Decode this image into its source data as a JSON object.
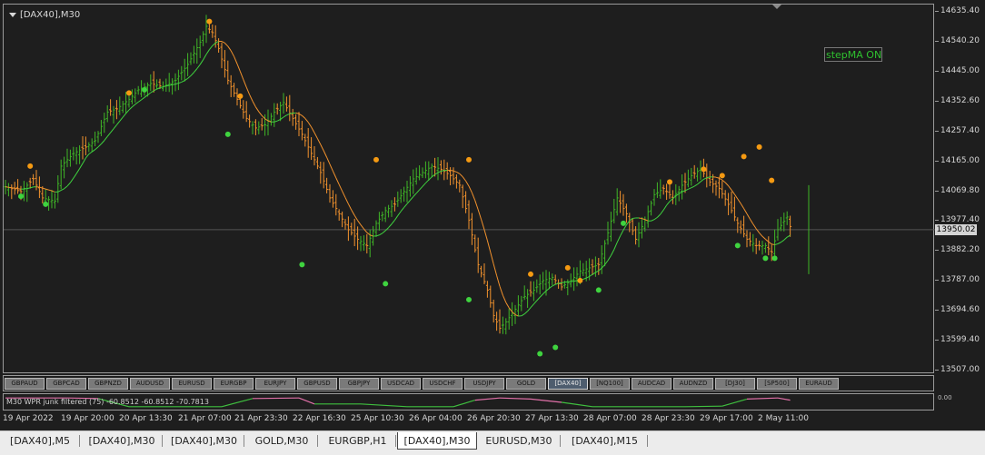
{
  "window": {
    "title": "[DAX40],M30"
  },
  "stepma_label": "stepMA ON",
  "price_axis": {
    "ticks": [
      "14635.40",
      "14540.20",
      "14445.00",
      "14352.60",
      "14257.40",
      "14165.00",
      "14069.80",
      "13977.40",
      "13882.20",
      "13787.00",
      "13694.60",
      "13599.40",
      "13507.00"
    ],
    "current": "13950.02"
  },
  "symbols": [
    "GBPAUD",
    "GBPCAD",
    "GBPNZD",
    "AUDUSD",
    "EURUSD",
    "EURGBP",
    "EURJPY",
    "GBPUSD",
    "GBPJPY",
    "USDCAD",
    "USDCHF",
    "USDJPY",
    "GOLD",
    "[DAX40]",
    "[NQ100]",
    "AUDCAD",
    "AUDNZD",
    "[DJ30]",
    "[SP500]",
    "EURAUD"
  ],
  "active_symbol": "[DAX40]",
  "indicator": {
    "label": "M30 WPR junk filtered (75) -60.8512 -60.8512 -70.7813",
    "axis_label": "0.00"
  },
  "time_axis": [
    "19 Apr 2022",
    "19 Apr 20:00",
    "20 Apr 13:30",
    "21 Apr 07:00",
    "21 Apr 23:30",
    "22 Apr 16:30",
    "25 Apr 10:30",
    "26 Apr 04:00",
    "26 Apr 20:30",
    "27 Apr 13:30",
    "28 Apr 07:00",
    "28 Apr 23:30",
    "29 Apr 17:00",
    "2 May 11:00"
  ],
  "tabs": [
    "[DAX40],M5",
    "[DAX40],M30",
    "[DAX40],M30",
    "GOLD,M30",
    "EURGBP,H1",
    "[DAX40],M30",
    "EURUSD,M30",
    "[DAX40],M15"
  ],
  "active_tab": 5,
  "colors": {
    "bull": "#3fb527",
    "bear": "#f2922d",
    "ma": "#f2922d",
    "signal": "#3fd33f",
    "wpr_high": "#e070a8",
    "wpr_low": "#3fbf3f"
  },
  "chart_data": {
    "type": "line",
    "ylim": [
      13507.0,
      14635.4
    ],
    "price_ticks": [
      14635.4,
      14540.2,
      14445.0,
      14352.6,
      14257.4,
      14165.0,
      14069.8,
      13977.4,
      13882.2,
      13787.0,
      13694.6,
      13599.4,
      13507.0
    ],
    "current_price": 13950.02,
    "x_labels": [
      "19 Apr 2022",
      "19 Apr 20:00",
      "20 Apr 13:30",
      "21 Apr 07:00",
      "21 Apr 23:30",
      "22 Apr 16:30",
      "25 Apr 10:30",
      "26 Apr 04:00",
      "26 Apr 20:30",
      "27 Apr 13:30",
      "28 Apr 07:00",
      "28 Apr 23:30",
      "29 Apr 17:00",
      "2 May 11:00"
    ],
    "close_keypoints": [
      [
        0,
        14085
      ],
      [
        5,
        14070
      ],
      [
        9,
        14110
      ],
      [
        12,
        14050
      ],
      [
        16,
        14040
      ],
      [
        18,
        14150
      ],
      [
        22,
        14190
      ],
      [
        26,
        14210
      ],
      [
        29,
        14230
      ],
      [
        33,
        14320
      ],
      [
        36,
        14330
      ],
      [
        40,
        14360
      ],
      [
        43,
        14390
      ],
      [
        47,
        14410
      ],
      [
        51,
        14400
      ],
      [
        55,
        14420
      ],
      [
        59,
        14470
      ],
      [
        63,
        14540
      ],
      [
        65,
        14590
      ],
      [
        67,
        14570
      ],
      [
        69,
        14520
      ],
      [
        72,
        14420
      ],
      [
        75,
        14360
      ],
      [
        78,
        14300
      ],
      [
        81,
        14270
      ],
      [
        84,
        14280
      ],
      [
        87,
        14320
      ],
      [
        90,
        14350
      ],
      [
        93,
        14300
      ],
      [
        96,
        14250
      ],
      [
        99,
        14190
      ],
      [
        102,
        14130
      ],
      [
        105,
        14050
      ],
      [
        108,
        14000
      ],
      [
        111,
        13950
      ],
      [
        114,
        13920
      ],
      [
        117,
        13900
      ],
      [
        120,
        13970
      ],
      [
        123,
        14010
      ],
      [
        126,
        14030
      ],
      [
        129,
        14070
      ],
      [
        132,
        14110
      ],
      [
        135,
        14130
      ],
      [
        138,
        14150
      ],
      [
        141,
        14140
      ],
      [
        144,
        14120
      ],
      [
        147,
        14090
      ],
      [
        150,
        13980
      ],
      [
        153,
        13840
      ],
      [
        156,
        13760
      ],
      [
        158,
        13680
      ],
      [
        160,
        13640
      ],
      [
        162,
        13660
      ],
      [
        165,
        13700
      ],
      [
        168,
        13740
      ],
      [
        171,
        13760
      ],
      [
        174,
        13790
      ],
      [
        177,
        13800
      ],
      [
        180,
        13770
      ],
      [
        183,
        13790
      ],
      [
        186,
        13820
      ],
      [
        189,
        13830
      ],
      [
        192,
        13840
      ],
      [
        195,
        13940
      ],
      [
        198,
        14050
      ],
      [
        201,
        14000
      ],
      [
        204,
        13920
      ],
      [
        207,
        13980
      ],
      [
        210,
        14060
      ],
      [
        213,
        14080
      ],
      [
        216,
        14050
      ],
      [
        219,
        14090
      ],
      [
        222,
        14120
      ],
      [
        225,
        14140
      ],
      [
        228,
        14100
      ],
      [
        231,
        14080
      ],
      [
        234,
        14030
      ],
      [
        237,
        13970
      ],
      [
        240,
        13920
      ],
      [
        243,
        13900
      ],
      [
        246,
        13900
      ],
      [
        248,
        13880
      ],
      [
        250,
        13950
      ],
      [
        253,
        13990
      ],
      [
        254,
        13960
      ]
    ],
    "wpr_levels": [
      [
        0,
        0.9
      ],
      [
        10,
        0.9
      ],
      [
        20,
        0.9
      ],
      [
        30,
        0.85
      ],
      [
        40,
        0.1
      ],
      [
        55,
        0.1
      ],
      [
        70,
        0.1
      ],
      [
        80,
        0.85
      ],
      [
        95,
        0.9
      ],
      [
        100,
        0.35
      ],
      [
        115,
        0.35
      ],
      [
        130,
        0.1
      ],
      [
        145,
        0.1
      ],
      [
        152,
        0.7
      ],
      [
        160,
        0.9
      ],
      [
        170,
        0.8
      ],
      [
        180,
        0.5
      ],
      [
        190,
        0.1
      ],
      [
        205,
        0.1
      ],
      [
        220,
        0.1
      ],
      [
        232,
        0.15
      ],
      [
        240,
        0.8
      ],
      [
        250,
        0.9
      ],
      [
        254,
        0.7
      ]
    ],
    "up_signals": [
      [
        5,
        14055
      ],
      [
        13,
        14030
      ],
      [
        45,
        14390
      ],
      [
        72,
        14250
      ],
      [
        96,
        13840
      ],
      [
        123,
        13780
      ],
      [
        150,
        13730
      ],
      [
        173,
        13560
      ],
      [
        178,
        13580
      ],
      [
        192,
        13760
      ],
      [
        200,
        13970
      ],
      [
        237,
        13900
      ],
      [
        246,
        13860
      ],
      [
        249,
        13860
      ]
    ],
    "down_signals": [
      [
        8,
        14150
      ],
      [
        40,
        14380
      ],
      [
        66,
        14605
      ],
      [
        76,
        14370
      ],
      [
        120,
        14170
      ],
      [
        150,
        14170
      ],
      [
        170,
        13810
      ],
      [
        182,
        13830
      ],
      [
        186,
        13790
      ],
      [
        215,
        14100
      ],
      [
        226,
        14140
      ],
      [
        232,
        14120
      ],
      [
        239,
        14180
      ],
      [
        244,
        14210
      ],
      [
        248,
        14105
      ]
    ]
  }
}
